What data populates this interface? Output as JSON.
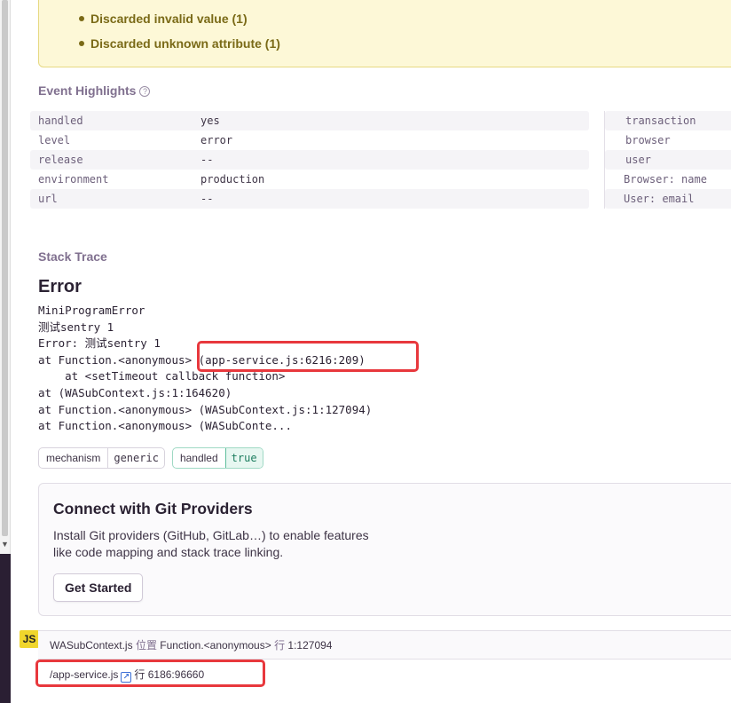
{
  "warnings": [
    "Discarded invalid value (1)",
    "Discarded unknown attribute (1)"
  ],
  "highlights": {
    "title": "Event Highlights",
    "help_icon": "?",
    "rows": [
      {
        "key": "handled",
        "value": "yes"
      },
      {
        "key": "level",
        "value": "error"
      },
      {
        "key": "release",
        "value": "--"
      },
      {
        "key": "environment",
        "value": "production"
      },
      {
        "key": "url",
        "value": "--"
      }
    ],
    "right_keys": [
      "transaction",
      "browser",
      "user",
      "Browser: name",
      "User: email"
    ]
  },
  "stack": {
    "title": "Stack Trace",
    "error_title": "Error",
    "lines": [
      "MiniProgramError",
      "测试sentry 1",
      "Error: 测试sentry 1",
      "at Function.<anonymous> (app-service.js:6216:209)",
      "    at <setTimeout callback function>",
      "at (WASubContext.js:1:164620)",
      "at Function.<anonymous> (WASubContext.js:1:127094)",
      "at Function.<anonymous> (WASubConte..."
    ],
    "tags": [
      {
        "key": "mechanism",
        "value": "generic"
      },
      {
        "key": "handled",
        "value": "true"
      }
    ]
  },
  "git": {
    "title": "Connect with Git Providers",
    "description": "Install Git providers (GitHub, GitLab…) to enable features like code mapping and stack trace linking.",
    "button": "Get Started"
  },
  "frames": {
    "badge": "JS",
    "frame1": {
      "file": "WASubContext.js",
      "at_label": "位置",
      "fn": "Function.<anonymous>",
      "line_label": "行",
      "line": "1:127094"
    },
    "frame2": {
      "file": "/app-service.js",
      "line_label": "行",
      "line": "6186:96660"
    }
  },
  "colors": {
    "highlight_box": "#e8383d",
    "warning_bg": "#fdf8d7",
    "js_badge": "#f0d62c"
  }
}
